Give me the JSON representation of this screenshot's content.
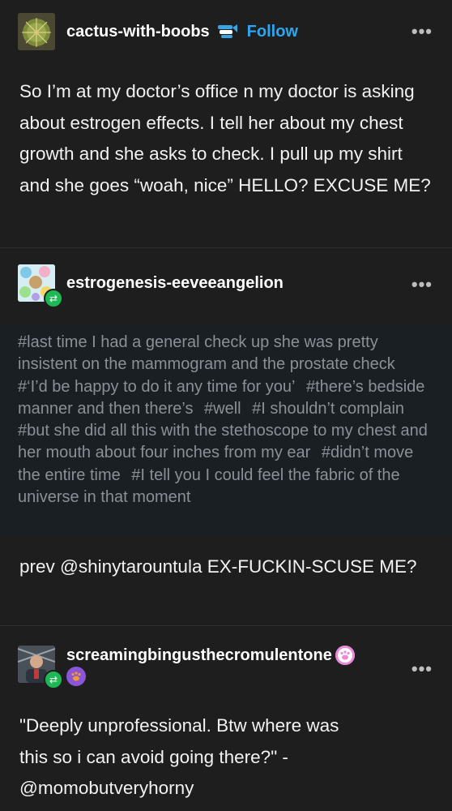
{
  "posts": [
    {
      "username": "cactus-with-boobs",
      "follow_label": "Follow",
      "more_label": "•••",
      "avatar_icon": "cactus-avatar",
      "badge_icon": "fish-badge",
      "body": "So I’m at my doctor’s office n my doctor is asking about estrogen effects. I tell her about my chest growth and she asks to check. I pull up my shirt and she goes “woah, nice” HELLO? EXCUSE ME?"
    },
    {
      "username": "estrogenesis-eeveeangelion",
      "more_label": "•••",
      "avatar_icon": "eevee-collage-avatar",
      "reblog_icon": "reblog-icon",
      "tags": [
        "#last time I had a general check up she was pretty insistent on the mammogram and the prostate check",
        "#‘I’d be happy to do it any time for you’",
        "#there’s bedside manner and then there’s",
        "#well",
        "#I shouldn’t complain",
        "#but she did all this with the stethoscope to my chest and her mouth about four inches from my ear",
        "#didn’t move the entire time",
        "#I tell you I could feel the fabric of the universe in that moment"
      ],
      "body": "prev @shinytarountula EX-FUCKIN-SCUSE ME?"
    },
    {
      "username": "screamingbingusthecromulentone",
      "more_label": "•••",
      "avatar_icon": "person-avatar",
      "reblog_icon": "reblog-icon",
      "badge_icons": [
        "paw-badge-pink",
        "paw-badge-orange"
      ],
      "body": "\"Deeply unprofessional. Btw where was this so i can avoid going there?\" - @momobutveryhorny"
    }
  ],
  "colors": {
    "background": "#1e1e1e",
    "follow": "#2aa7f1",
    "tags_background": "#1a1f24",
    "tags_text": "#8a9096",
    "reblog_badge": "#1db954"
  }
}
